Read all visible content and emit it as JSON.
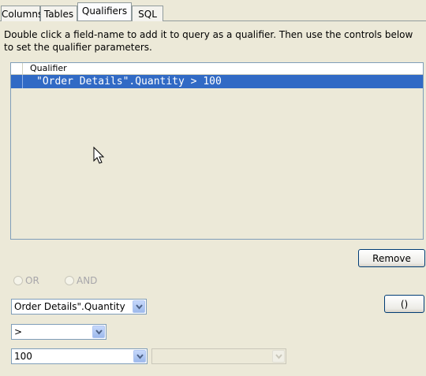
{
  "tabs": [
    {
      "label": "Columns",
      "active": false
    },
    {
      "label": "Tables",
      "active": false
    },
    {
      "label": "Qualifiers",
      "active": true
    },
    {
      "label": "SQL",
      "active": false
    }
  ],
  "instructions": "Double click a field-name to add it to query as a qualifier.  Then use the controls below to set the qualifier parameters.",
  "table": {
    "column_header": "Qualifier",
    "rows": [
      "\"Order Details\".Quantity > 100"
    ]
  },
  "buttons": {
    "remove": "Remove",
    "parens": "()"
  },
  "radios": {
    "or": "OR",
    "and": "AND"
  },
  "combos": {
    "field": "Order Details\".Quantity",
    "operator": ">",
    "value": "100",
    "value2": ""
  },
  "colors": {
    "selection": "#316ac5",
    "background": "#ece9d8"
  },
  "icons": {
    "cursor": "mouse-pointer-icon",
    "dropdown": "chevron-down-icon"
  }
}
